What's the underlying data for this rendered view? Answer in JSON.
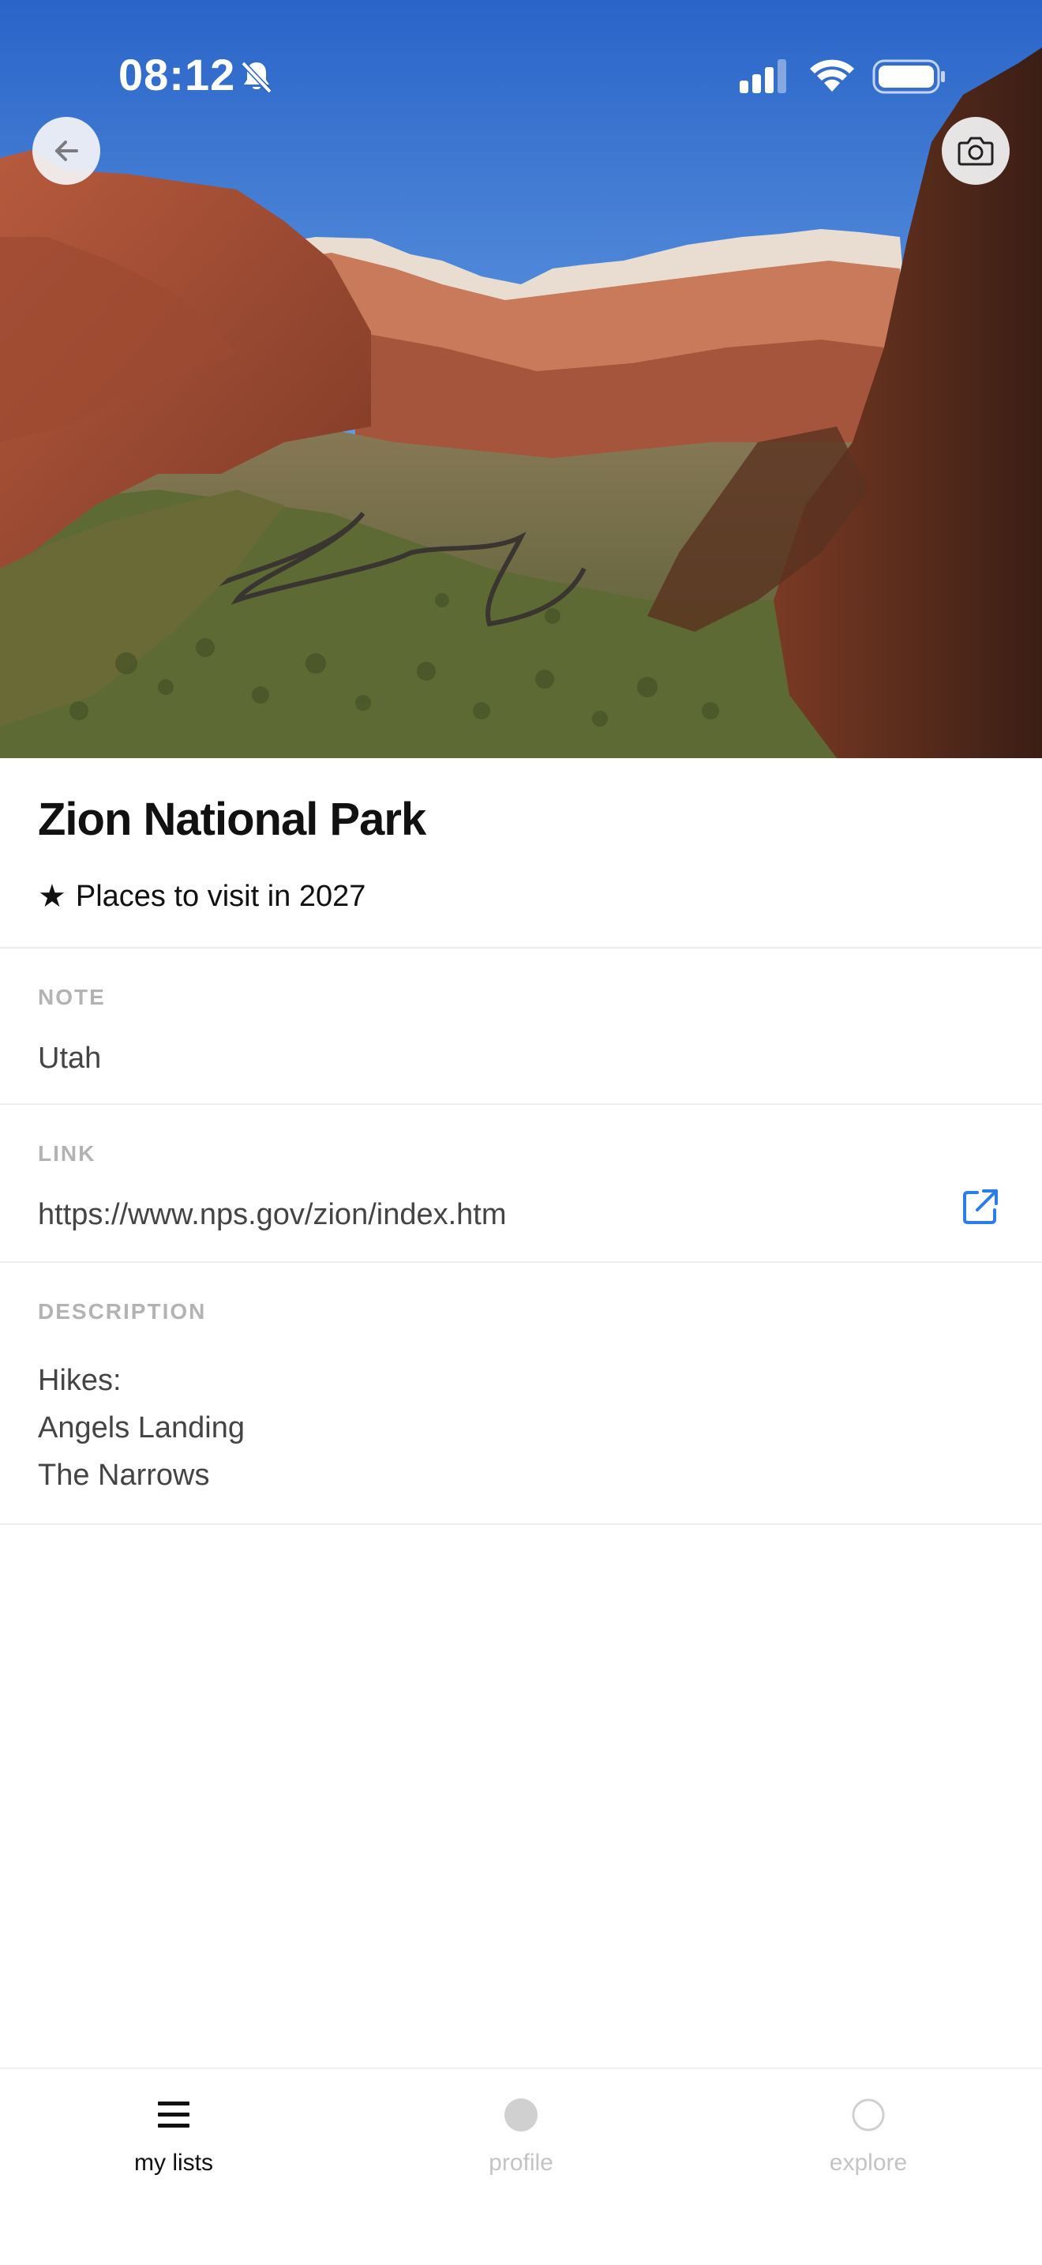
{
  "status_bar": {
    "time": "08:12",
    "icons": [
      "bell-slash-icon",
      "cellular-signal-icon",
      "wifi-icon",
      "battery-icon"
    ]
  },
  "hero": {
    "back_icon": "arrow-left-icon",
    "camera_icon": "camera-icon"
  },
  "item": {
    "title": "Zion National Park",
    "list_star": "★",
    "list_name": "Places to visit in 2027"
  },
  "sections": {
    "note": {
      "label": "NOTE",
      "value": "Utah"
    },
    "link": {
      "label": "LINK",
      "value": "https://www.nps.gov/zion/index.htm",
      "icon": "external-link-icon"
    },
    "description": {
      "label": "DESCRIPTION",
      "lines": [
        "Hikes:",
        "Angels Landing",
        "The Narrows"
      ]
    }
  },
  "tabbar": {
    "tabs": [
      {
        "label": "my lists",
        "icon": "list-icon",
        "active": true
      },
      {
        "label": "profile",
        "icon": "filled-circle-icon",
        "active": false
      },
      {
        "label": "explore",
        "icon": "circle-outline-icon",
        "active": false
      }
    ]
  },
  "colors": {
    "accent": "#2b7de9",
    "sky_top": "#2a64c8",
    "sky_bottom": "#7cb8f2",
    "label_gray": "#b3b3b3",
    "divider": "#ececec"
  }
}
